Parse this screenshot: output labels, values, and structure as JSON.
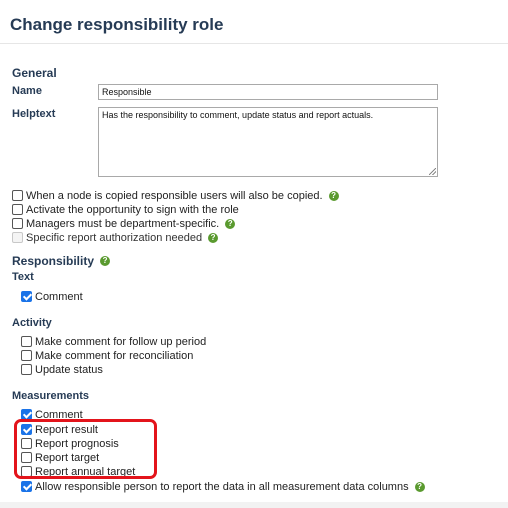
{
  "title": "Change responsibility role",
  "general": {
    "heading": "General",
    "name_label": "Name",
    "name_value": "Responsible",
    "helptext_label": "Helptext",
    "helptext_value": "Has the responsibility to comment, update status and report actuals."
  },
  "options": [
    {
      "label": "When a node is copied responsible users will also be copied.",
      "checked": false,
      "help": true
    },
    {
      "label": "Activate the opportunity to sign with the role",
      "checked": false,
      "help": false
    },
    {
      "label": "Managers must be department-specific.",
      "checked": false,
      "help": true
    },
    {
      "label": "Specific report authorization needed",
      "checked": false,
      "disabled": true,
      "help": true
    }
  ],
  "responsibility": {
    "heading": "Responsibility",
    "text_label": "Text",
    "text_items": [
      {
        "label": "Comment",
        "checked": true
      }
    ],
    "activity_label": "Activity",
    "activity_items": [
      {
        "label": "Make comment for follow up period",
        "checked": false
      },
      {
        "label": "Make comment for reconciliation",
        "checked": false
      },
      {
        "label": "Update status",
        "checked": false
      }
    ],
    "measurements_label": "Measurements",
    "measurement_items": [
      {
        "label": "Comment",
        "checked": true
      },
      {
        "label": "Report result",
        "checked": true
      },
      {
        "label": "Report prognosis",
        "checked": false
      },
      {
        "label": "Report target",
        "checked": false
      },
      {
        "label": "Report annual target",
        "checked": false
      },
      {
        "label": "Allow responsible person to report the data in all measurement data columns",
        "checked": true
      }
    ]
  },
  "help_glyph": "?",
  "colors": {
    "heading": "#263b55",
    "checkbox_checked": "#1a73e8",
    "help": "#5a9a2f",
    "highlight": "#e3141b"
  }
}
